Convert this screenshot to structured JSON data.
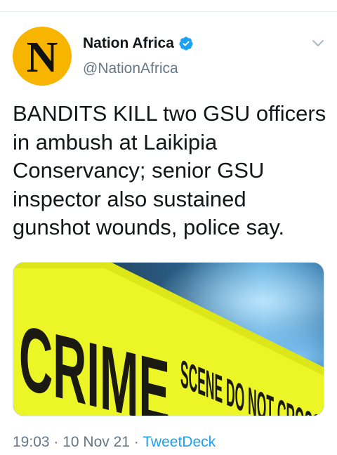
{
  "author": {
    "avatar_letter": "N",
    "display_name": "Nation Africa",
    "handle": "@NationAfrica",
    "verified_icon": "verified-badge-icon"
  },
  "tweet": {
    "text": "BANDITS KILL two GSU officers in ambush at Laikipia Conservancy; senior GSU inspector also sustained gunshot wounds, police say."
  },
  "media": {
    "tape_text_large": "CRIME",
    "tape_text_small": "SCENE DO NOT CROSS"
  },
  "meta": {
    "time": "19:03",
    "sep1": " · ",
    "date": "10 Nov 21",
    "sep2": " · ",
    "source": "TweetDeck"
  },
  "colors": {
    "accent": "#1da1f2",
    "avatar_bg": "#f7b500",
    "tape": "#e6f21a"
  }
}
